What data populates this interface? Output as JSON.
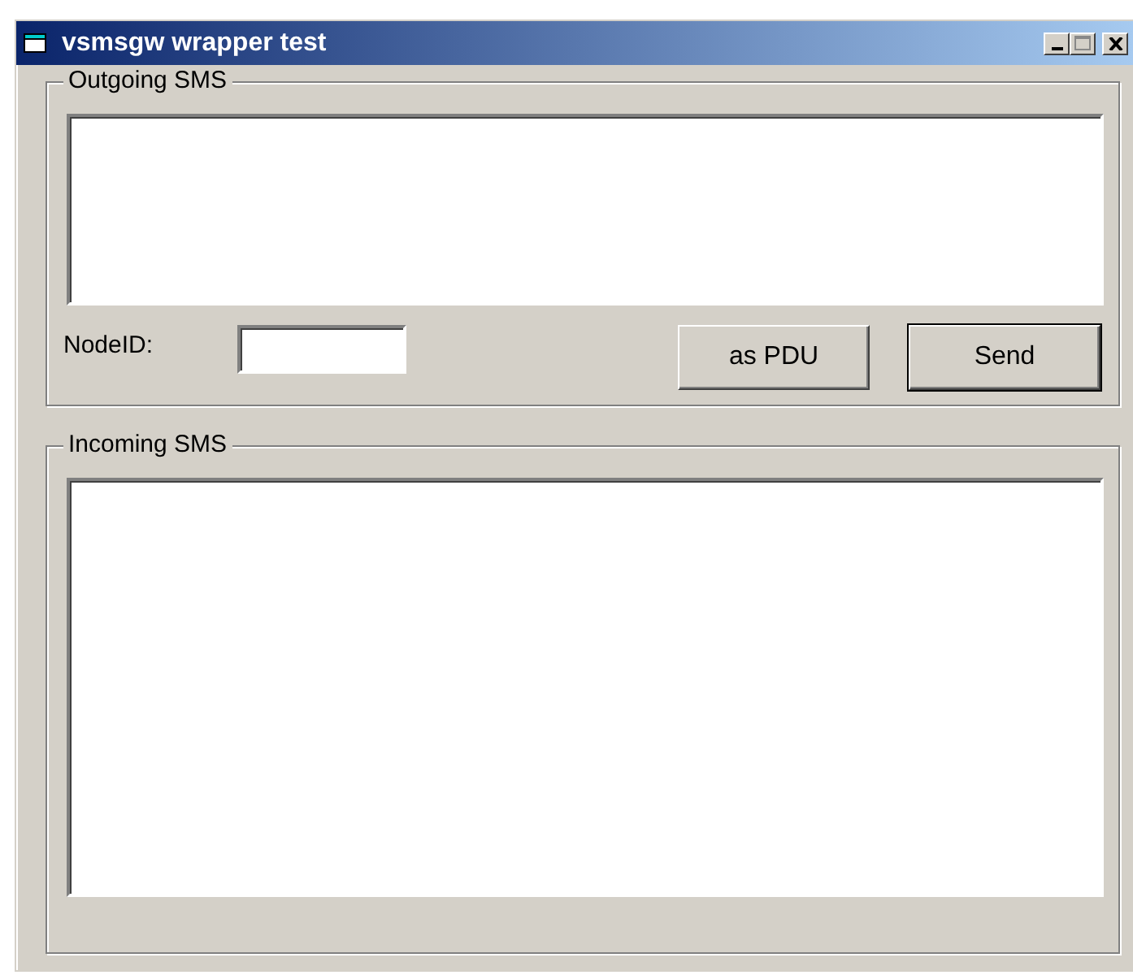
{
  "window": {
    "title": "vsmsgw wrapper test"
  },
  "outgoing": {
    "legend": "Outgoing SMS",
    "node_label": "NodeID:",
    "buttons": [
      {
        "label": "as PDU",
        "default": false
      },
      {
        "label": "Send",
        "default": true
      }
    ]
  },
  "incoming": {
    "legend": "Incoming SMS"
  }
}
